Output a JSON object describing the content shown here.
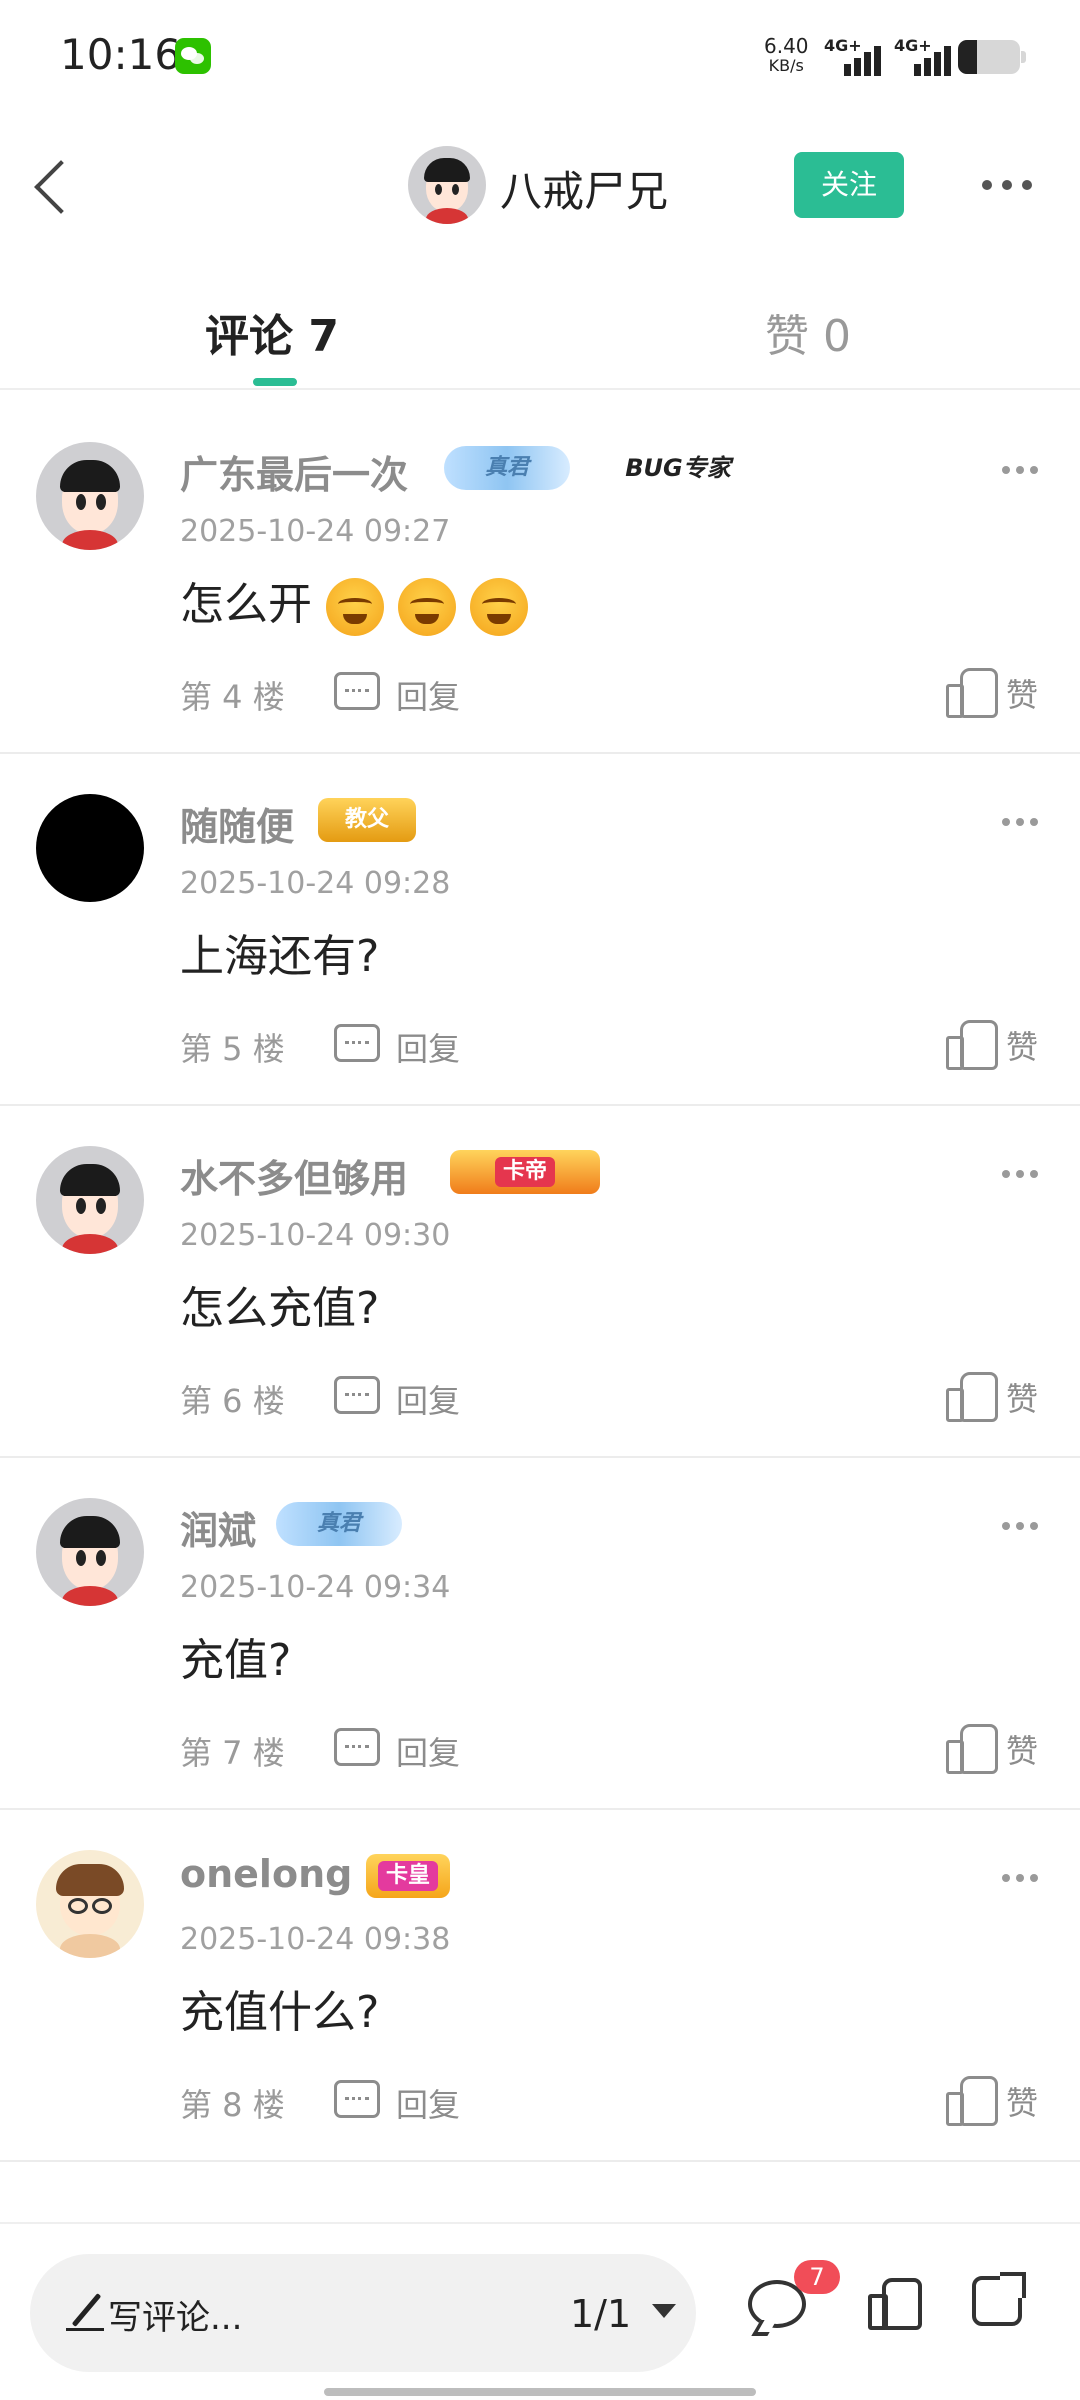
{
  "status_bar": {
    "time": "10:16",
    "network_speed": "6.40",
    "network_unit": "KB/s",
    "sim1": "4G+",
    "sim2": "4G+",
    "battery_level": 0.3
  },
  "header": {
    "back_icon": "back-arrow-icon",
    "username": "八戒尸兄",
    "follow_label": "关注",
    "more_icon": "more-icon",
    "accent": "#2bbd94"
  },
  "tabs": [
    {
      "label": "评论 7",
      "active": true
    },
    {
      "label": "赞 0",
      "active": false
    }
  ],
  "comments": [
    {
      "name": "广东最后一次",
      "badges": [
        "真君",
        "BUG专家"
      ],
      "time": "2025-10-24 09:27",
      "text": "怎么开",
      "emoji_count": 3,
      "floor": "第 4 楼",
      "reply": "回复",
      "like": "赞"
    },
    {
      "name": "随随便",
      "badges": [
        "教父"
      ],
      "time": "2025-10-24 09:28",
      "text": "上海还有?",
      "floor": "第 5 楼",
      "reply": "回复",
      "like": "赞"
    },
    {
      "name": "水不多但够用",
      "badges": [
        "卡帝"
      ],
      "time": "2025-10-24 09:30",
      "text": "怎么充值?",
      "floor": "第 6 楼",
      "reply": "回复",
      "like": "赞"
    },
    {
      "name": "润斌",
      "badges": [
        "真君"
      ],
      "time": "2025-10-24 09:34",
      "text": "充值?",
      "floor": "第 7 楼",
      "reply": "回复",
      "like": "赞"
    },
    {
      "name": "onelong",
      "badges": [
        "卡皇"
      ],
      "time": "2025-10-24 09:38",
      "text": "充值什么?",
      "floor": "第 8 楼",
      "reply": "回复",
      "like": "赞"
    }
  ],
  "bottom_bar": {
    "comment_placeholder": "写评论...",
    "page_indicator": "1/1",
    "notification_count": "7",
    "icons": [
      "pencil-icon",
      "caret-down-icon",
      "chat-bubble-icon",
      "thumb-up-icon",
      "share-icon"
    ]
  }
}
